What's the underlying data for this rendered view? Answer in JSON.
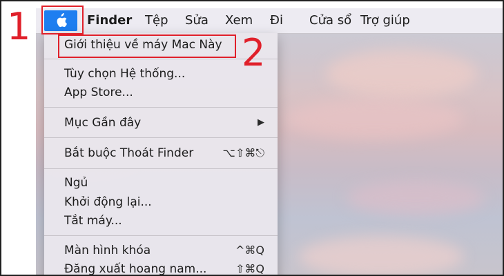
{
  "menubar": {
    "items": [
      "Finder",
      "Tệp",
      "Sửa",
      "Xem",
      "Đi",
      "Cửa sổ",
      "Trợ giúp"
    ]
  },
  "apple_menu": {
    "items": [
      {
        "label": "Giới thiệu về máy Mac Này",
        "shortcut": ""
      },
      {
        "label": "Tùy chọn Hệ thống...",
        "shortcut": ""
      },
      {
        "label": "App Store...",
        "shortcut": ""
      },
      {
        "label": "Mục Gần đây",
        "shortcut": "▶"
      },
      {
        "label": "Bắt buộc Thoát Finder",
        "shortcut": "⌥⇧⌘⎋"
      },
      {
        "label": "Ngủ",
        "shortcut": ""
      },
      {
        "label": "Khởi động lại...",
        "shortcut": ""
      },
      {
        "label": "Tắt máy...",
        "shortcut": ""
      },
      {
        "label": "Màn hình khóa",
        "shortcut": "^⌘Q"
      },
      {
        "label": "Đăng xuất hoang nam...",
        "shortcut": "⇧⌘Q"
      }
    ]
  },
  "annotations": {
    "step1": "1",
    "step2": "2"
  },
  "colors": {
    "apple_button": "#1e7ef0",
    "annotation_red": "#e0202a"
  },
  "icons": {
    "apple": "apple-icon",
    "submenu": "submenu-arrow-icon"
  }
}
